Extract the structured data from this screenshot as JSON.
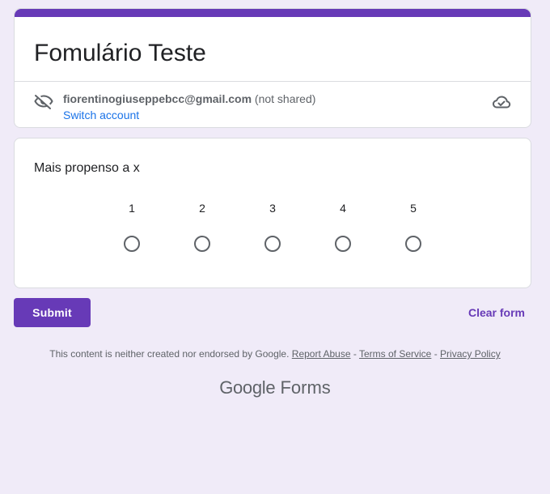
{
  "form": {
    "title": "Fomulário Teste",
    "accent_color": "#673ab7",
    "background_color": "#f0ebf8"
  },
  "account": {
    "email": "fiorentinogiuseppebcc@gmail.com",
    "shared_status": "(not shared)",
    "switch_label": "Switch account",
    "icons": [
      "eye-off-icon",
      "cloud-saved-icon"
    ]
  },
  "question": {
    "title": "Mais propenso a x",
    "scale": [
      "1",
      "2",
      "3",
      "4",
      "5"
    ]
  },
  "actions": {
    "submit_label": "Submit",
    "clear_label": "Clear form"
  },
  "footer": {
    "disclaimer": "This content is neither created nor endorsed by Google.",
    "report_abuse": "Report Abuse",
    "terms": "Terms of Service",
    "privacy": "Privacy Policy",
    "separator": "-",
    "logo_google": "Google",
    "logo_forms": "Forms"
  }
}
